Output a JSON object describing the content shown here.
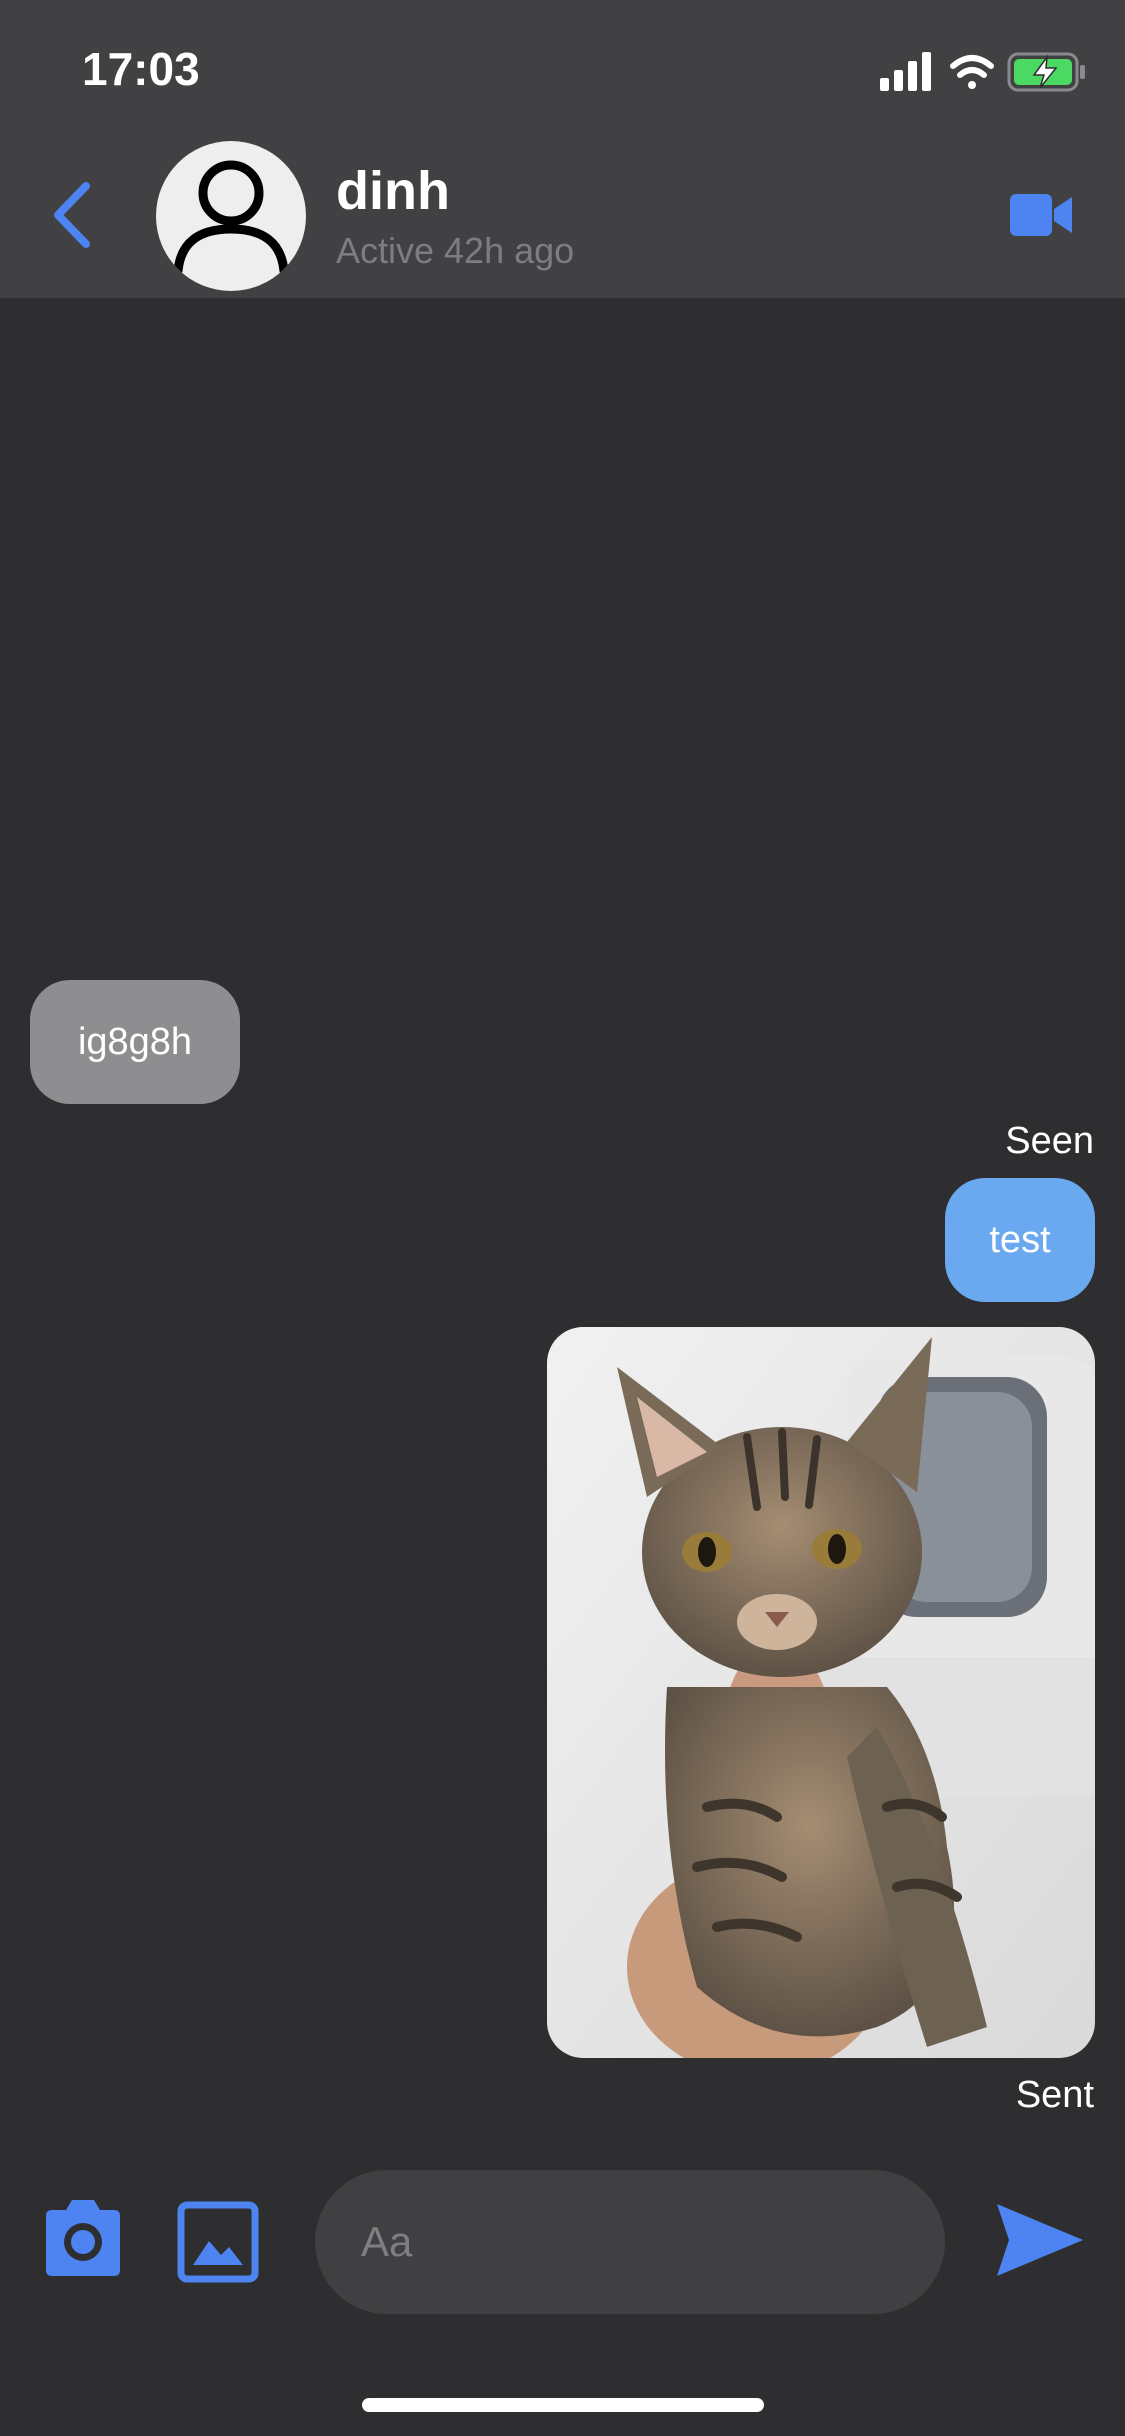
{
  "status_bar": {
    "time": "17:03",
    "icons": [
      "signal-icon",
      "wifi-icon",
      "battery-charging-icon"
    ]
  },
  "header": {
    "back_icon": "chevron-left-icon",
    "avatar_icon": "person-icon",
    "contact_name": "dinh",
    "contact_status": "Active 42h ago",
    "video_icon": "video-camera-icon"
  },
  "messages": [
    {
      "direction": "incoming",
      "type": "text",
      "text": "ig8g8h"
    },
    {
      "direction": "outgoing",
      "type": "text",
      "text": "test",
      "status_above": "Seen"
    },
    {
      "direction": "outgoing",
      "type": "image",
      "subject": "tabby kitten",
      "status_below": "Sent"
    }
  ],
  "composer": {
    "camera_icon": "camera-icon",
    "gallery_icon": "image-icon",
    "placeholder": "Aa",
    "value": "",
    "send_icon": "send-icon"
  },
  "colors": {
    "background": "#2e2e30",
    "header": "#414143",
    "accent": "#4d84f2",
    "outgoing_bubble": "#6aa8ef",
    "incoming_bubble": "#8e8e90",
    "input_bg": "#404042",
    "battery_green": "#4bd964"
  }
}
